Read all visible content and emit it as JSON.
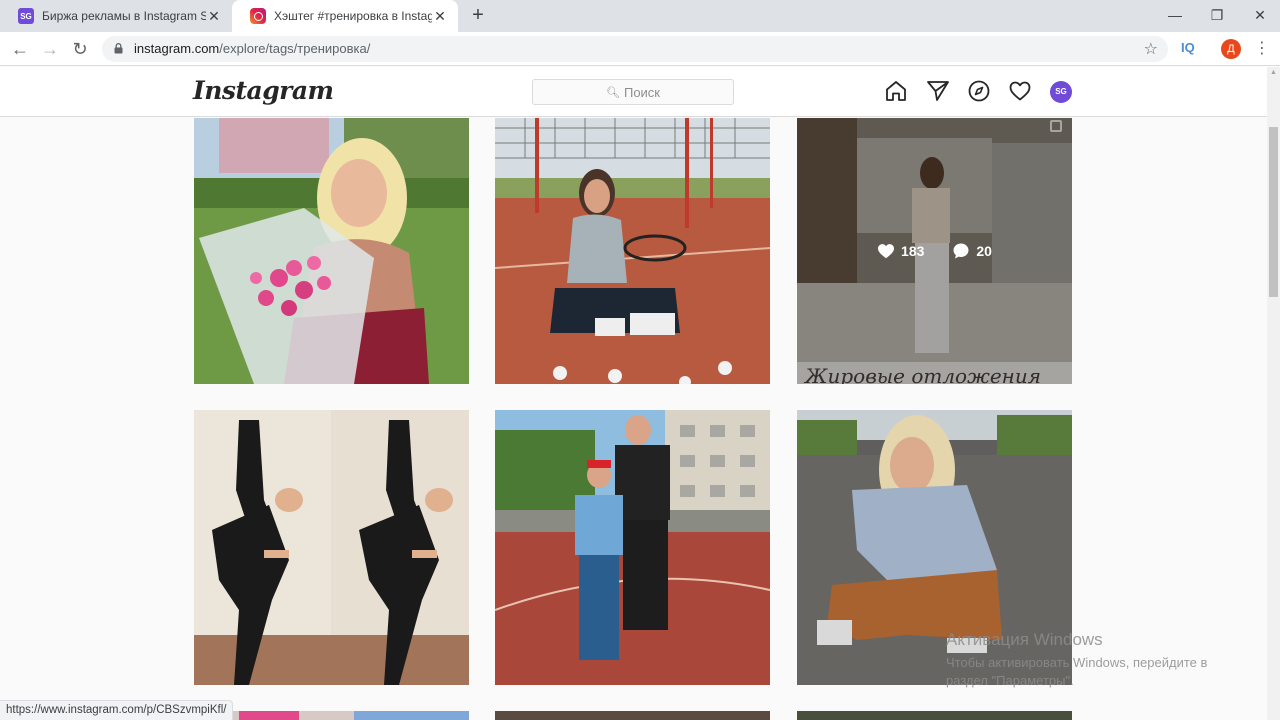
{
  "browser": {
    "tabs": [
      {
        "title": "Биржа рекламы в Instagram Sto",
        "favicon": "sg-logo-icon"
      },
      {
        "title": "Хэштег #тренировка в Instagram",
        "favicon": "instagram-icon"
      }
    ],
    "url_host": "instagram.com",
    "url_path": "/explore/tags/тренировка/",
    "extension_iq": "IQ",
    "profile_initial": "Д",
    "status_url": "https://www.instagram.com/p/CBSzvmpiKfl/"
  },
  "ig": {
    "logo": "Instagram",
    "search_placeholder": "Поиск",
    "avatar_text": "SG"
  },
  "posts": [
    {
      "alt": "woman-with-flowers-photo"
    },
    {
      "alt": "woman-sitting-on-court-photo"
    },
    {
      "alt": "woman-gym-mirror-photo",
      "likes": "183",
      "comments": "20",
      "caption_fragment": "Жировые отложения"
    },
    {
      "alt": "gymnast-stretch-photo"
    },
    {
      "alt": "boy-and-trainer-photo"
    },
    {
      "alt": "woman-squatting-road-photo"
    }
  ],
  "watermark": {
    "title": "Активация Windows",
    "line1": "Чтобы активировать Windows, перейдите в",
    "line2": "раздел \"Параметры\"."
  },
  "colors": {
    "tabstrip": "#dee1e6",
    "ig_text": "#262626",
    "avatar_purple": "#6f4bd8",
    "profile_orange": "#e8481b"
  }
}
